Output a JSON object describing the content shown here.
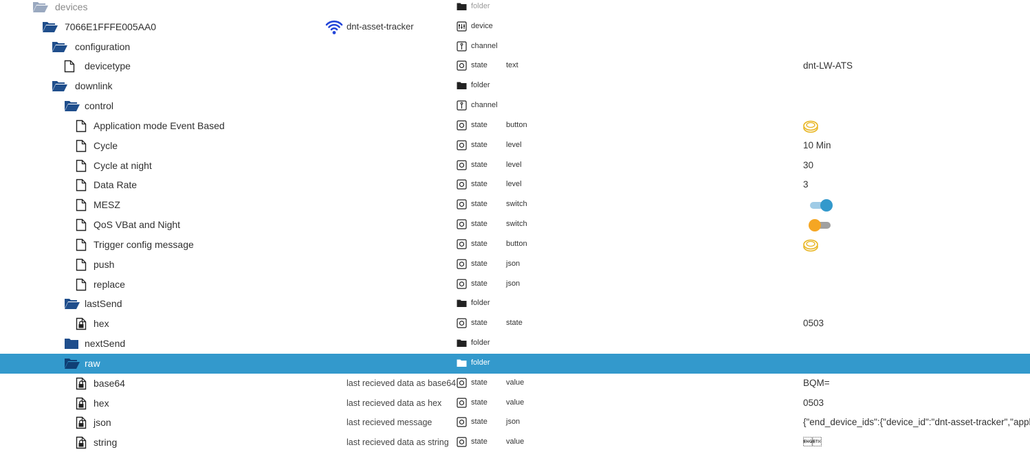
{
  "colors": {
    "folder_dark": "#1f4e8c",
    "folder_faded": "#9aa9c0",
    "selected_row": "#3399cc",
    "button_gold": "#e8b520",
    "switch_on": "#3399cc",
    "switch_on_track": "#9fcbe6",
    "switch_off_thumb": "#f5a623",
    "switch_off_track": "#a0a0a0",
    "wifi_blue": "#2345d8"
  },
  "rows": [
    {
      "name": "devices",
      "icon": "folder-open-icon",
      "level": 0,
      "faded": true,
      "type": "folder",
      "type_icon": "folder-icon"
    },
    {
      "name": "7066E1FFFE005AA0",
      "icon": "folder-open-icon",
      "level": 1,
      "device_name": "dnt-asset-tracker",
      "device_icon": "wifi-icon",
      "type": "device",
      "type_icon": "device-icon"
    },
    {
      "name": "configuration",
      "icon": "folder-open-icon",
      "level": 2,
      "type": "channel",
      "type_icon": "channel-icon"
    },
    {
      "name": "devicetype",
      "icon": "file-icon",
      "level": 3,
      "type": "state",
      "type_icon": "state-icon",
      "role": "text",
      "value": "dnt-LW-ATS"
    },
    {
      "name": "downlink",
      "icon": "folder-open-icon",
      "level": 2,
      "type": "folder",
      "type_icon": "folder-icon"
    },
    {
      "name": "control",
      "icon": "folder-open-icon",
      "level": 3,
      "type": "channel",
      "type_icon": "channel-icon"
    },
    {
      "name": "Application mode Event Based",
      "icon": "file-icon",
      "level": 4,
      "type": "state",
      "type_icon": "state-icon",
      "role": "button",
      "value_icon": "button-icon"
    },
    {
      "name": "Cycle",
      "icon": "file-icon",
      "level": 4,
      "type": "state",
      "type_icon": "state-icon",
      "role": "level",
      "value": "10 Min"
    },
    {
      "name": "Cycle at night",
      "icon": "file-icon",
      "level": 4,
      "type": "state",
      "type_icon": "state-icon",
      "role": "level",
      "value": "30"
    },
    {
      "name": "Data Rate",
      "icon": "file-icon",
      "level": 4,
      "type": "state",
      "type_icon": "state-icon",
      "role": "level",
      "value": "3"
    },
    {
      "name": "MESZ",
      "icon": "file-icon",
      "level": 4,
      "type": "state",
      "type_icon": "state-icon",
      "role": "switch",
      "switch": true
    },
    {
      "name": "QoS VBat and Night",
      "icon": "file-icon",
      "level": 4,
      "type": "state",
      "type_icon": "state-icon",
      "role": "switch",
      "switch": false
    },
    {
      "name": "Trigger config message",
      "icon": "file-icon",
      "level": 4,
      "type": "state",
      "type_icon": "state-icon",
      "role": "button",
      "value_icon": "button-icon"
    },
    {
      "name": "push",
      "icon": "file-icon",
      "level": 4,
      "type": "state",
      "type_icon": "state-icon",
      "role": "json"
    },
    {
      "name": "replace",
      "icon": "file-icon",
      "level": 4,
      "type": "state",
      "type_icon": "state-icon",
      "role": "json"
    },
    {
      "name": "lastSend",
      "icon": "folder-open-icon",
      "level": 3,
      "type": "folder",
      "type_icon": "folder-icon"
    },
    {
      "name": "hex",
      "icon": "file-lock-icon",
      "level": 4,
      "type": "state",
      "type_icon": "state-icon",
      "role": "state",
      "value": "0503"
    },
    {
      "name": "nextSend",
      "icon": "folder-closed-icon",
      "level": 3,
      "type": "folder",
      "type_icon": "folder-icon"
    },
    {
      "name": "raw",
      "icon": "folder-open-icon",
      "level": 3,
      "selected": true,
      "type": "folder",
      "type_icon": "folder-icon"
    },
    {
      "name": "base64",
      "icon": "file-lock-icon",
      "level": 4,
      "description": "last recieved data as base64",
      "type": "state",
      "type_icon": "state-icon",
      "role": "value",
      "value": "BQM="
    },
    {
      "name": "hex",
      "icon": "file-lock-icon",
      "level": 4,
      "description": "last recieved data as hex",
      "type": "state",
      "type_icon": "state-icon",
      "role": "value",
      "value": "0503"
    },
    {
      "name": "json",
      "icon": "file-lock-icon",
      "level": 4,
      "description": "last recieved message",
      "type": "state",
      "type_icon": "state-icon",
      "role": "json",
      "value": "{\"end_device_ids\":{\"device_id\":\"dnt-asset-tracker\",\"application_ids\":{"
    },
    {
      "name": "string",
      "icon": "file-lock-icon",
      "level": 4,
      "description": "last recieved data as string",
      "type": "state",
      "type_icon": "state-icon",
      "role": "value",
      "value": "\u0005\u0003"
    }
  ]
}
